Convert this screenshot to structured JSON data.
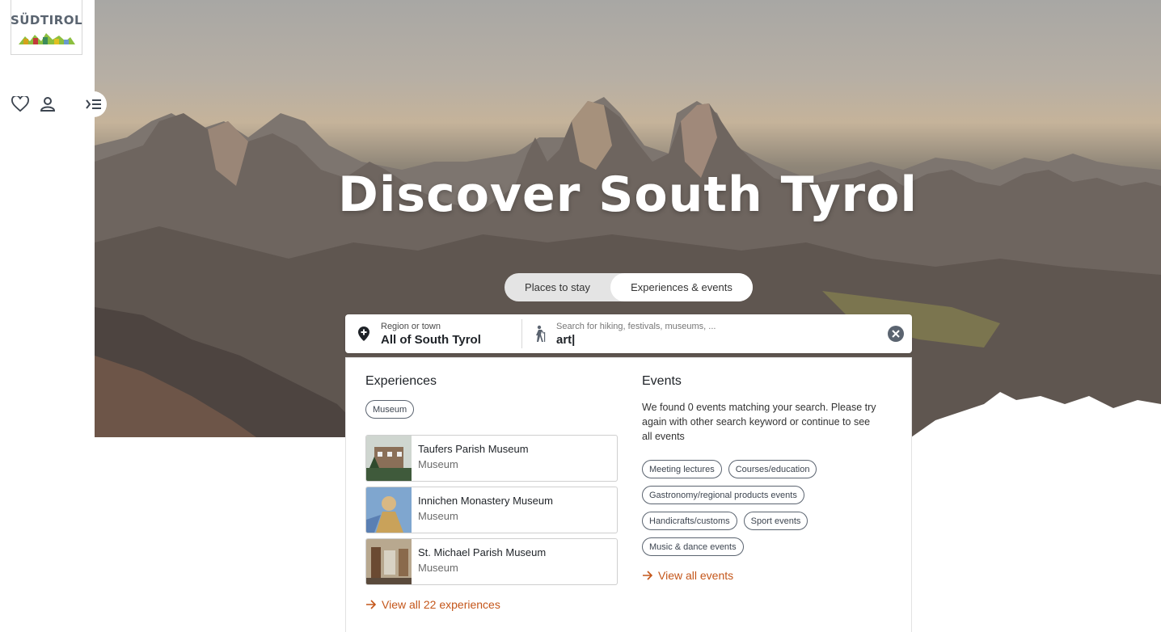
{
  "brand": {
    "logo_text": "SÜDTIROL"
  },
  "hero": {
    "title": "Discover South Tyrol"
  },
  "mode_switch": {
    "left": "Places to stay",
    "right": "Experiences & events",
    "active": "right"
  },
  "search": {
    "region_label": "Region or town",
    "region_value": "All of South Tyrol",
    "query_placeholder": "Search for hiking, festivals, museums, ...",
    "query_value": "art|"
  },
  "experiences": {
    "title": "Experiences",
    "filter_tag": "Museum",
    "items": [
      {
        "name": "Taufers Parish Museum",
        "type": "Museum"
      },
      {
        "name": "Innichen Monastery Museum",
        "type": "Museum"
      },
      {
        "name": "St. Michael Parish Museum",
        "type": "Museum"
      }
    ],
    "view_all": "View all 22 experiences"
  },
  "events": {
    "title": "Events",
    "message": "We found 0 events matching your search. Please try again with other search keyword or continue to see all events",
    "tags": [
      "Meeting lectures",
      "Courses/education",
      "Gastronomy/regional products events",
      "Handicrafts/customs",
      "Sport events",
      "Music & dance events"
    ],
    "view_all": "View all events"
  },
  "colors": {
    "accent": "#c4561a",
    "icon": "#5b6470"
  }
}
